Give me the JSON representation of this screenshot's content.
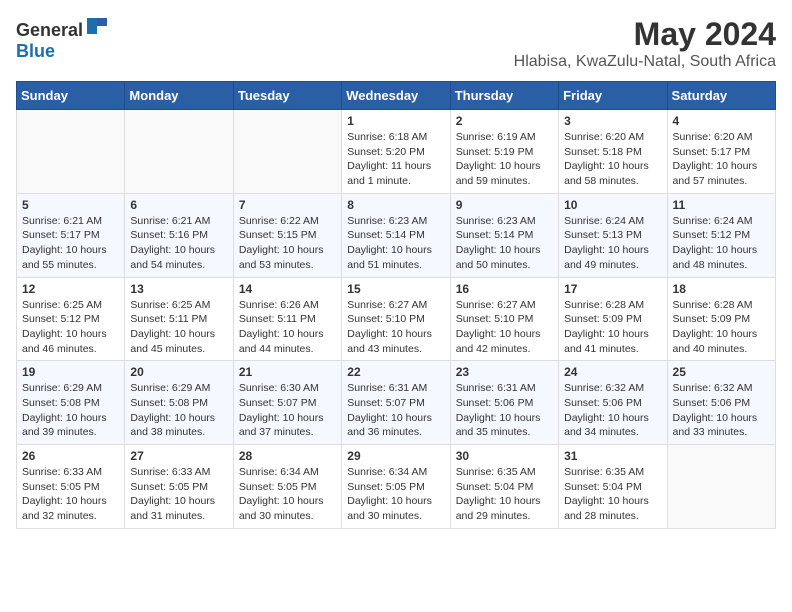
{
  "header": {
    "logo_general": "General",
    "logo_blue": "Blue",
    "title": "May 2024",
    "subtitle": "Hlabisa, KwaZulu-Natal, South Africa"
  },
  "calendar": {
    "weekdays": [
      "Sunday",
      "Monday",
      "Tuesday",
      "Wednesday",
      "Thursday",
      "Friday",
      "Saturday"
    ],
    "weeks": [
      [
        {
          "day": "",
          "info": ""
        },
        {
          "day": "",
          "info": ""
        },
        {
          "day": "",
          "info": ""
        },
        {
          "day": "1",
          "info": "Sunrise: 6:18 AM\nSunset: 5:20 PM\nDaylight: 11 hours\nand 1 minute."
        },
        {
          "day": "2",
          "info": "Sunrise: 6:19 AM\nSunset: 5:19 PM\nDaylight: 10 hours\nand 59 minutes."
        },
        {
          "day": "3",
          "info": "Sunrise: 6:20 AM\nSunset: 5:18 PM\nDaylight: 10 hours\nand 58 minutes."
        },
        {
          "day": "4",
          "info": "Sunrise: 6:20 AM\nSunset: 5:17 PM\nDaylight: 10 hours\nand 57 minutes."
        }
      ],
      [
        {
          "day": "5",
          "info": "Sunrise: 6:21 AM\nSunset: 5:17 PM\nDaylight: 10 hours\nand 55 minutes."
        },
        {
          "day": "6",
          "info": "Sunrise: 6:21 AM\nSunset: 5:16 PM\nDaylight: 10 hours\nand 54 minutes."
        },
        {
          "day": "7",
          "info": "Sunrise: 6:22 AM\nSunset: 5:15 PM\nDaylight: 10 hours\nand 53 minutes."
        },
        {
          "day": "8",
          "info": "Sunrise: 6:23 AM\nSunset: 5:14 PM\nDaylight: 10 hours\nand 51 minutes."
        },
        {
          "day": "9",
          "info": "Sunrise: 6:23 AM\nSunset: 5:14 PM\nDaylight: 10 hours\nand 50 minutes."
        },
        {
          "day": "10",
          "info": "Sunrise: 6:24 AM\nSunset: 5:13 PM\nDaylight: 10 hours\nand 49 minutes."
        },
        {
          "day": "11",
          "info": "Sunrise: 6:24 AM\nSunset: 5:12 PM\nDaylight: 10 hours\nand 48 minutes."
        }
      ],
      [
        {
          "day": "12",
          "info": "Sunrise: 6:25 AM\nSunset: 5:12 PM\nDaylight: 10 hours\nand 46 minutes."
        },
        {
          "day": "13",
          "info": "Sunrise: 6:25 AM\nSunset: 5:11 PM\nDaylight: 10 hours\nand 45 minutes."
        },
        {
          "day": "14",
          "info": "Sunrise: 6:26 AM\nSunset: 5:11 PM\nDaylight: 10 hours\nand 44 minutes."
        },
        {
          "day": "15",
          "info": "Sunrise: 6:27 AM\nSunset: 5:10 PM\nDaylight: 10 hours\nand 43 minutes."
        },
        {
          "day": "16",
          "info": "Sunrise: 6:27 AM\nSunset: 5:10 PM\nDaylight: 10 hours\nand 42 minutes."
        },
        {
          "day": "17",
          "info": "Sunrise: 6:28 AM\nSunset: 5:09 PM\nDaylight: 10 hours\nand 41 minutes."
        },
        {
          "day": "18",
          "info": "Sunrise: 6:28 AM\nSunset: 5:09 PM\nDaylight: 10 hours\nand 40 minutes."
        }
      ],
      [
        {
          "day": "19",
          "info": "Sunrise: 6:29 AM\nSunset: 5:08 PM\nDaylight: 10 hours\nand 39 minutes."
        },
        {
          "day": "20",
          "info": "Sunrise: 6:29 AM\nSunset: 5:08 PM\nDaylight: 10 hours\nand 38 minutes."
        },
        {
          "day": "21",
          "info": "Sunrise: 6:30 AM\nSunset: 5:07 PM\nDaylight: 10 hours\nand 37 minutes."
        },
        {
          "day": "22",
          "info": "Sunrise: 6:31 AM\nSunset: 5:07 PM\nDaylight: 10 hours\nand 36 minutes."
        },
        {
          "day": "23",
          "info": "Sunrise: 6:31 AM\nSunset: 5:06 PM\nDaylight: 10 hours\nand 35 minutes."
        },
        {
          "day": "24",
          "info": "Sunrise: 6:32 AM\nSunset: 5:06 PM\nDaylight: 10 hours\nand 34 minutes."
        },
        {
          "day": "25",
          "info": "Sunrise: 6:32 AM\nSunset: 5:06 PM\nDaylight: 10 hours\nand 33 minutes."
        }
      ],
      [
        {
          "day": "26",
          "info": "Sunrise: 6:33 AM\nSunset: 5:05 PM\nDaylight: 10 hours\nand 32 minutes."
        },
        {
          "day": "27",
          "info": "Sunrise: 6:33 AM\nSunset: 5:05 PM\nDaylight: 10 hours\nand 31 minutes."
        },
        {
          "day": "28",
          "info": "Sunrise: 6:34 AM\nSunset: 5:05 PM\nDaylight: 10 hours\nand 30 minutes."
        },
        {
          "day": "29",
          "info": "Sunrise: 6:34 AM\nSunset: 5:05 PM\nDaylight: 10 hours\nand 30 minutes."
        },
        {
          "day": "30",
          "info": "Sunrise: 6:35 AM\nSunset: 5:04 PM\nDaylight: 10 hours\nand 29 minutes."
        },
        {
          "day": "31",
          "info": "Sunrise: 6:35 AM\nSunset: 5:04 PM\nDaylight: 10 hours\nand 28 minutes."
        },
        {
          "day": "",
          "info": ""
        }
      ]
    ]
  }
}
